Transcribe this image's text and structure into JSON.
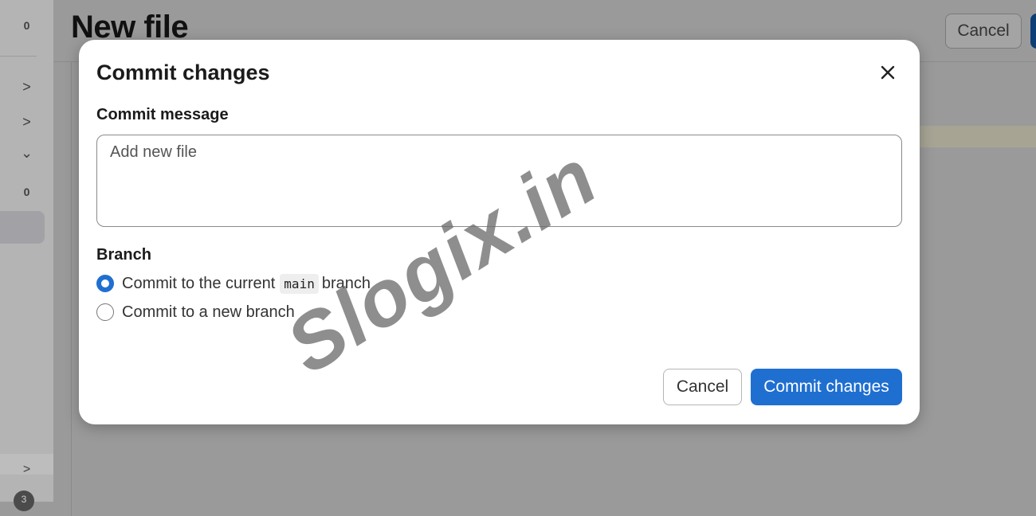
{
  "sidebar": {
    "items": [
      {
        "label": "0"
      },
      {
        "label": ">"
      },
      {
        "label": ">"
      },
      {
        "label": "⌄"
      },
      {
        "label": "0"
      },
      {
        "label": ">"
      }
    ],
    "help_badge": "3"
  },
  "page": {
    "title": "New file",
    "cancel_label": "Cancel"
  },
  "modal": {
    "title": "Commit changes",
    "message_label": "Commit message",
    "message_value": "Add new file",
    "branch_label": "Branch",
    "options": [
      {
        "prefix": "Commit to the current",
        "code": "main",
        "suffix": "branch",
        "checked": true
      },
      {
        "prefix": "Commit to a new branch",
        "checked": false
      }
    ],
    "cancel_label": "Cancel",
    "commit_label": "Commit changes"
  },
  "watermark": "Slogix.in",
  "colors": {
    "primary": "#1f6fd1",
    "overlay": "#9a9a9a"
  }
}
